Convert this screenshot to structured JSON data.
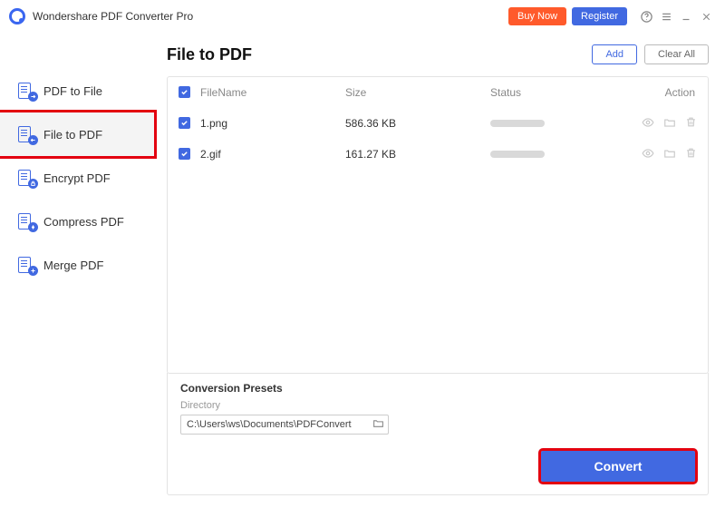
{
  "app": {
    "title": "Wondershare PDF Converter Pro"
  },
  "header": {
    "buy": "Buy Now",
    "register": "Register"
  },
  "sidebar": {
    "items": [
      {
        "label": "PDF to File"
      },
      {
        "label": "File to PDF"
      },
      {
        "label": "Encrypt PDF"
      },
      {
        "label": "Compress PDF"
      },
      {
        "label": "Merge PDF"
      }
    ],
    "activeIndex": 1
  },
  "main": {
    "title": "File to PDF",
    "add": "Add",
    "clear": "Clear All",
    "columns": {
      "name": "FileName",
      "size": "Size",
      "status": "Status",
      "action": "Action"
    },
    "rows": [
      {
        "name": "1.png",
        "size": "586.36 KB",
        "checked": true
      },
      {
        "name": "2.gif",
        "size": "161.27 KB",
        "checked": true
      }
    ]
  },
  "footer": {
    "presetsTitle": "Conversion Presets",
    "dirLabel": "Directory",
    "dirValue": "C:\\Users\\ws\\Documents\\PDFConvert",
    "convert": "Convert"
  }
}
